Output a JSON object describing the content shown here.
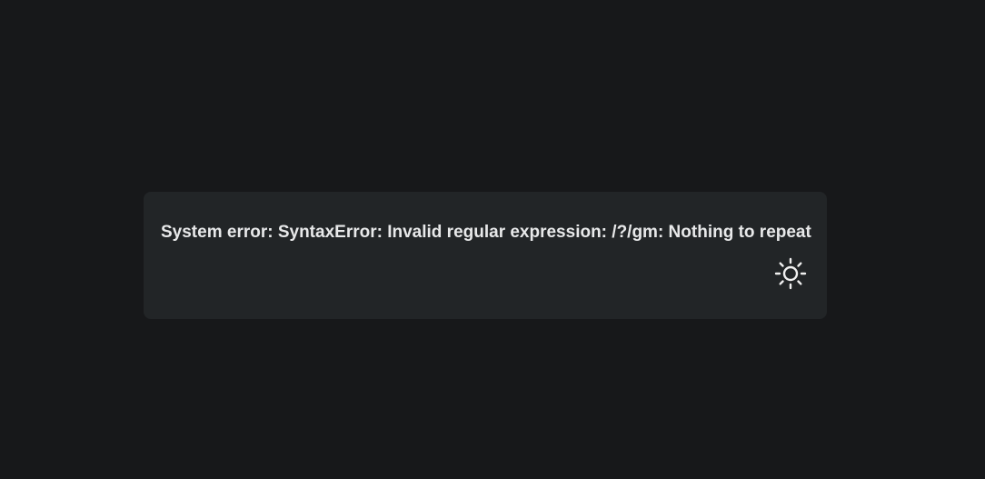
{
  "error_card": {
    "message": "System error: SyntaxError: Invalid regular expression: /?/gm: Nothing to repeat"
  },
  "theme_toggle": {
    "icon": "sun-icon"
  },
  "colors": {
    "background": "#17181a",
    "card": "#222527",
    "text": "#e8e9ea",
    "icon": "#f0f0f0"
  }
}
